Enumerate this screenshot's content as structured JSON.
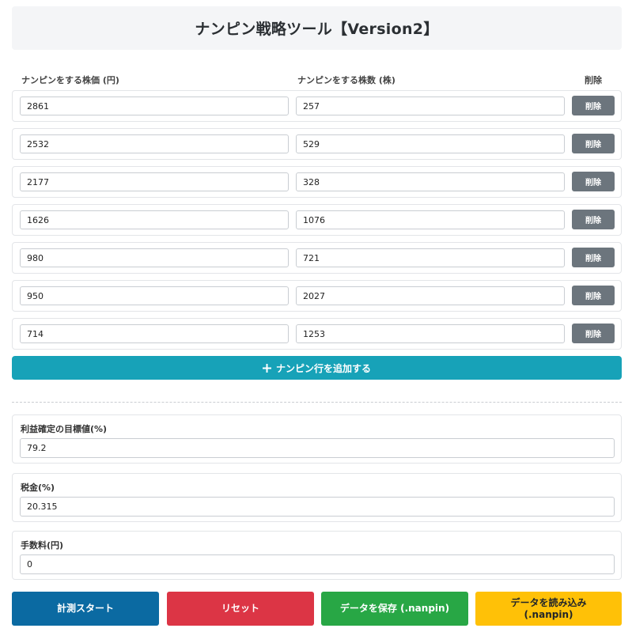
{
  "header": {
    "title": "ナンピン戦略ツール【Version2】"
  },
  "columns": {
    "price": "ナンピンをする株価 (円)",
    "qty": "ナンピンをする株数 (株)",
    "delete": "削除"
  },
  "rows": [
    {
      "price": "2861",
      "qty": "257",
      "delete_label": "削除"
    },
    {
      "price": "2532",
      "qty": "529",
      "delete_label": "削除"
    },
    {
      "price": "2177",
      "qty": "328",
      "delete_label": "削除"
    },
    {
      "price": "1626",
      "qty": "1076",
      "delete_label": "削除"
    },
    {
      "price": "980",
      "qty": "721",
      "delete_label": "削除"
    },
    {
      "price": "950",
      "qty": "2027",
      "delete_label": "削除"
    },
    {
      "price": "714",
      "qty": "1253",
      "delete_label": "削除"
    }
  ],
  "add_row": {
    "icon": "plus-icon",
    "label": "ナンピン行を追加する"
  },
  "settings": {
    "target_label": "利益確定の目標値(%)",
    "target_value": "79.2",
    "tax_label": "税金(%)",
    "tax_value": "20.315",
    "fee_label": "手数料(円)",
    "fee_value": "0"
  },
  "actions": {
    "start": "計測スタート",
    "reset": "リセット",
    "save": "データを保存 (.nanpin)",
    "load_line1": "データを読み込み",
    "load_line2": "(.nanpin)"
  },
  "colors": {
    "accent_teal": "#17a2b8",
    "start_blue": "#0b6aa2",
    "reset_red": "#dc3545",
    "save_green": "#28a745",
    "load_yellow": "#ffc107",
    "delete_gray": "#6c757d"
  }
}
